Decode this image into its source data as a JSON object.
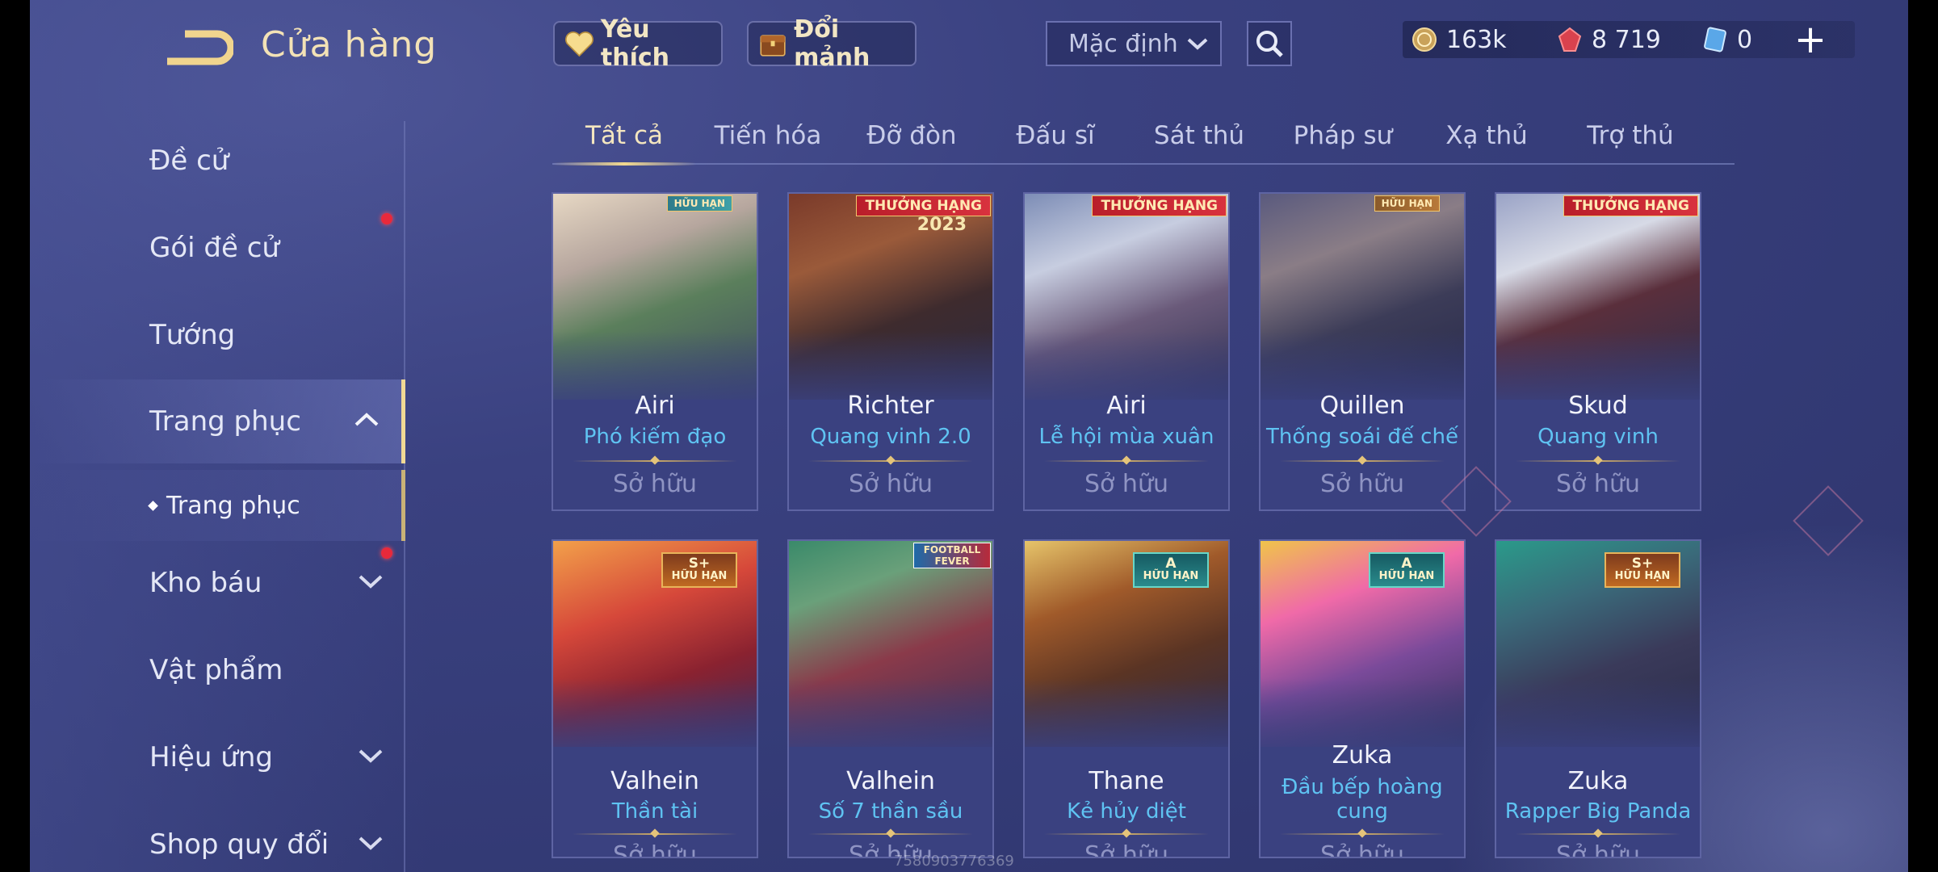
{
  "header": {
    "title": "Cửa hàng",
    "favorites_label": "Yêu thích",
    "fragments_label": "Đổi mảnh",
    "sort_value": "Mặc định"
  },
  "currency": {
    "gold": "163k",
    "ruby": "8 719",
    "voucher": "0"
  },
  "sidebar": {
    "items": [
      {
        "label": "Đề cử"
      },
      {
        "label": "Gói đề cử"
      },
      {
        "label": "Tướng"
      },
      {
        "label": "Trang phục"
      },
      {
        "label": "Kho báu"
      },
      {
        "label": "Vật phẩm"
      },
      {
        "label": "Hiệu ứng"
      },
      {
        "label": "Shop quy đổi"
      }
    ],
    "sub_item": "Trang phục"
  },
  "tabs": [
    "Tất cả",
    "Tiến hóa",
    "Đỡ đòn",
    "Đấu sĩ",
    "Sát thủ",
    "Pháp sư",
    "Xạ thủ",
    "Trợ thủ"
  ],
  "cards": [
    {
      "hero": "Airi",
      "skin": "Phó kiếm đạo",
      "status": "Sở hữu",
      "badge": "HỮU HẠN"
    },
    {
      "hero": "Richter",
      "skin": "Quang vinh 2.0",
      "status": "Sở hữu",
      "badge": "THƯỞNG HẠNG",
      "badge_extra": "2023"
    },
    {
      "hero": "Airi",
      "skin": "Lễ hội mùa xuân",
      "status": "Sở hữu",
      "badge": "THƯỞNG HẠNG"
    },
    {
      "hero": "Quillen",
      "skin": "Thống soái đế chế",
      "status": "Sở hữu",
      "badge": "HỮU HẠN"
    },
    {
      "hero": "Skud",
      "skin": "Quang vinh",
      "status": "Sở hữu",
      "badge": "THƯỞNG HẠNG"
    },
    {
      "hero": "Valhein",
      "skin": "Thần tài",
      "status": "Sở hữu",
      "grade": "S+",
      "grade_sub": "HỮU HẠN"
    },
    {
      "hero": "Valhein",
      "skin": "Số 7 thần sầu",
      "status": "Sở hữu",
      "badge": "FOOTBALL FEVER"
    },
    {
      "hero": "Thane",
      "skin": "Kẻ hủy diệt",
      "status": "Sở hữu",
      "grade": "A",
      "grade_sub": "HỮU HẠN"
    },
    {
      "hero": "Zuka",
      "skin": "Đầu bếp hoàng cung",
      "status": "Sở hữu",
      "grade": "A",
      "grade_sub": "HỮU HẠN"
    },
    {
      "hero": "Zuka",
      "skin": "Rapper Big Panda",
      "status": "Sở hữu",
      "grade": "S+",
      "grade_sub": "HỮU HẠN"
    }
  ],
  "watermark": "7580903776369"
}
